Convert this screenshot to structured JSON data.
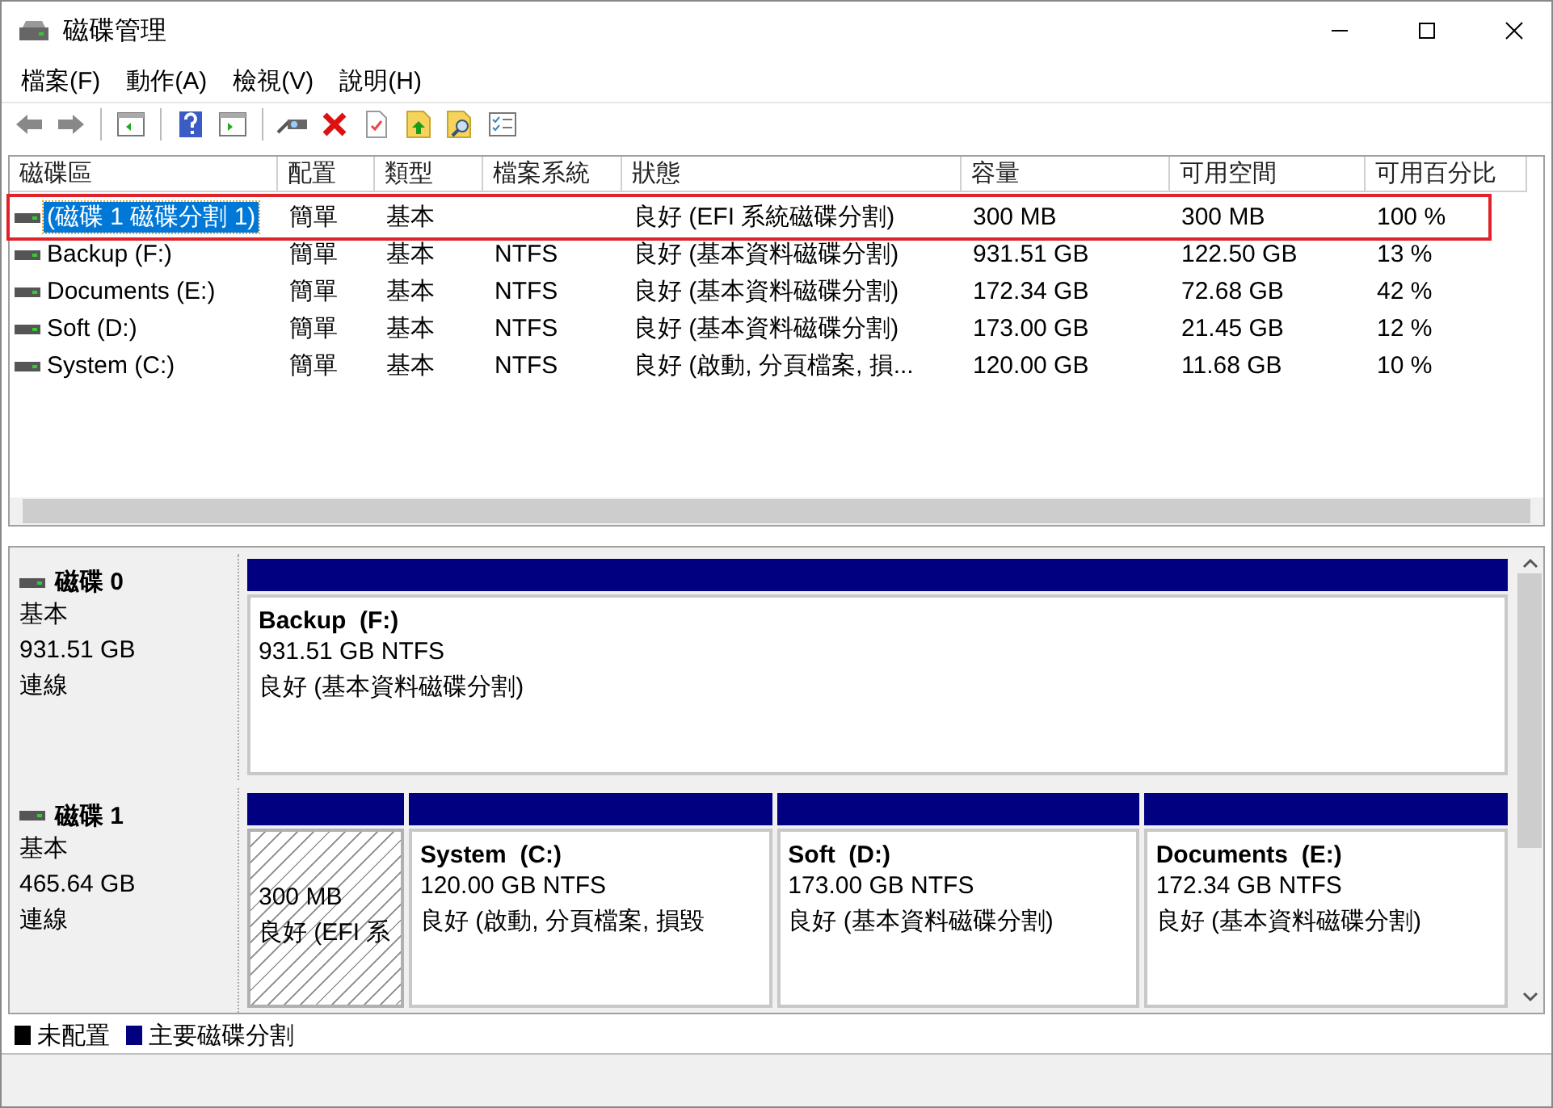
{
  "window": {
    "title": "磁碟管理"
  },
  "menu": [
    {
      "label": "檔案(F)"
    },
    {
      "label": "動作(A)"
    },
    {
      "label": "檢視(V)"
    },
    {
      "label": "說明(H)"
    }
  ],
  "volume_list": {
    "columns": [
      "磁碟區",
      "配置",
      "類型",
      "檔案系統",
      "狀態",
      "容量",
      "可用空間",
      "可用百分比"
    ],
    "rows": [
      {
        "selected": true,
        "highlighted": true,
        "cells": [
          "(磁碟 1 磁碟分割 1)",
          "簡單",
          "基本",
          "",
          "良好 (EFI 系統磁碟分割)",
          "300 MB",
          "300 MB",
          "100 %"
        ]
      },
      {
        "selected": false,
        "highlighted": false,
        "cells": [
          "Backup (F:)",
          "簡單",
          "基本",
          "NTFS",
          "良好 (基本資料磁碟分割)",
          "931.51 GB",
          "122.50 GB",
          "13 %"
        ]
      },
      {
        "selected": false,
        "highlighted": false,
        "cells": [
          "Documents (E:)",
          "簡單",
          "基本",
          "NTFS",
          "良好 (基本資料磁碟分割)",
          "172.34 GB",
          "72.68 GB",
          "42 %"
        ]
      },
      {
        "selected": false,
        "highlighted": false,
        "cells": [
          "Soft (D:)",
          "簡單",
          "基本",
          "NTFS",
          "良好 (基本資料磁碟分割)",
          "173.00 GB",
          "21.45 GB",
          "12 %"
        ]
      },
      {
        "selected": false,
        "highlighted": false,
        "cells": [
          "System (C:)",
          "簡單",
          "基本",
          "NTFS",
          "良好 (啟動, 分頁檔案, 損...",
          "120.00 GB",
          "11.68 GB",
          "10 %"
        ]
      }
    ]
  },
  "disks": [
    {
      "name": "磁碟 0",
      "type": "基本",
      "size": "931.51 GB",
      "status": "連線",
      "partitions": [
        {
          "kind": "primary",
          "title": "Backup  (F:)",
          "size": "931.51 GB NTFS",
          "status": "良好 (基本資料磁碟分割)"
        }
      ]
    },
    {
      "name": "磁碟 1",
      "type": "基本",
      "size": "465.64 GB",
      "status": "連線",
      "partitions": [
        {
          "kind": "efi",
          "size": "300 MB",
          "status": "良好 (EFI 系"
        },
        {
          "kind": "primary",
          "title": "System  (C:)",
          "size": "120.00 GB NTFS",
          "status": "良好 (啟動, 分頁檔案, 損毀"
        },
        {
          "kind": "primary",
          "title": "Soft  (D:)",
          "size": "173.00 GB NTFS",
          "status": "良好 (基本資料磁碟分割)"
        },
        {
          "kind": "primary",
          "title": "Documents  (E:)",
          "size": "172.34 GB NTFS",
          "status": "良好 (基本資料磁碟分割)"
        }
      ]
    }
  ],
  "legend": [
    {
      "label": "未配置",
      "color": "#000000"
    },
    {
      "label": "主要磁碟分割",
      "color": "#000080"
    }
  ]
}
